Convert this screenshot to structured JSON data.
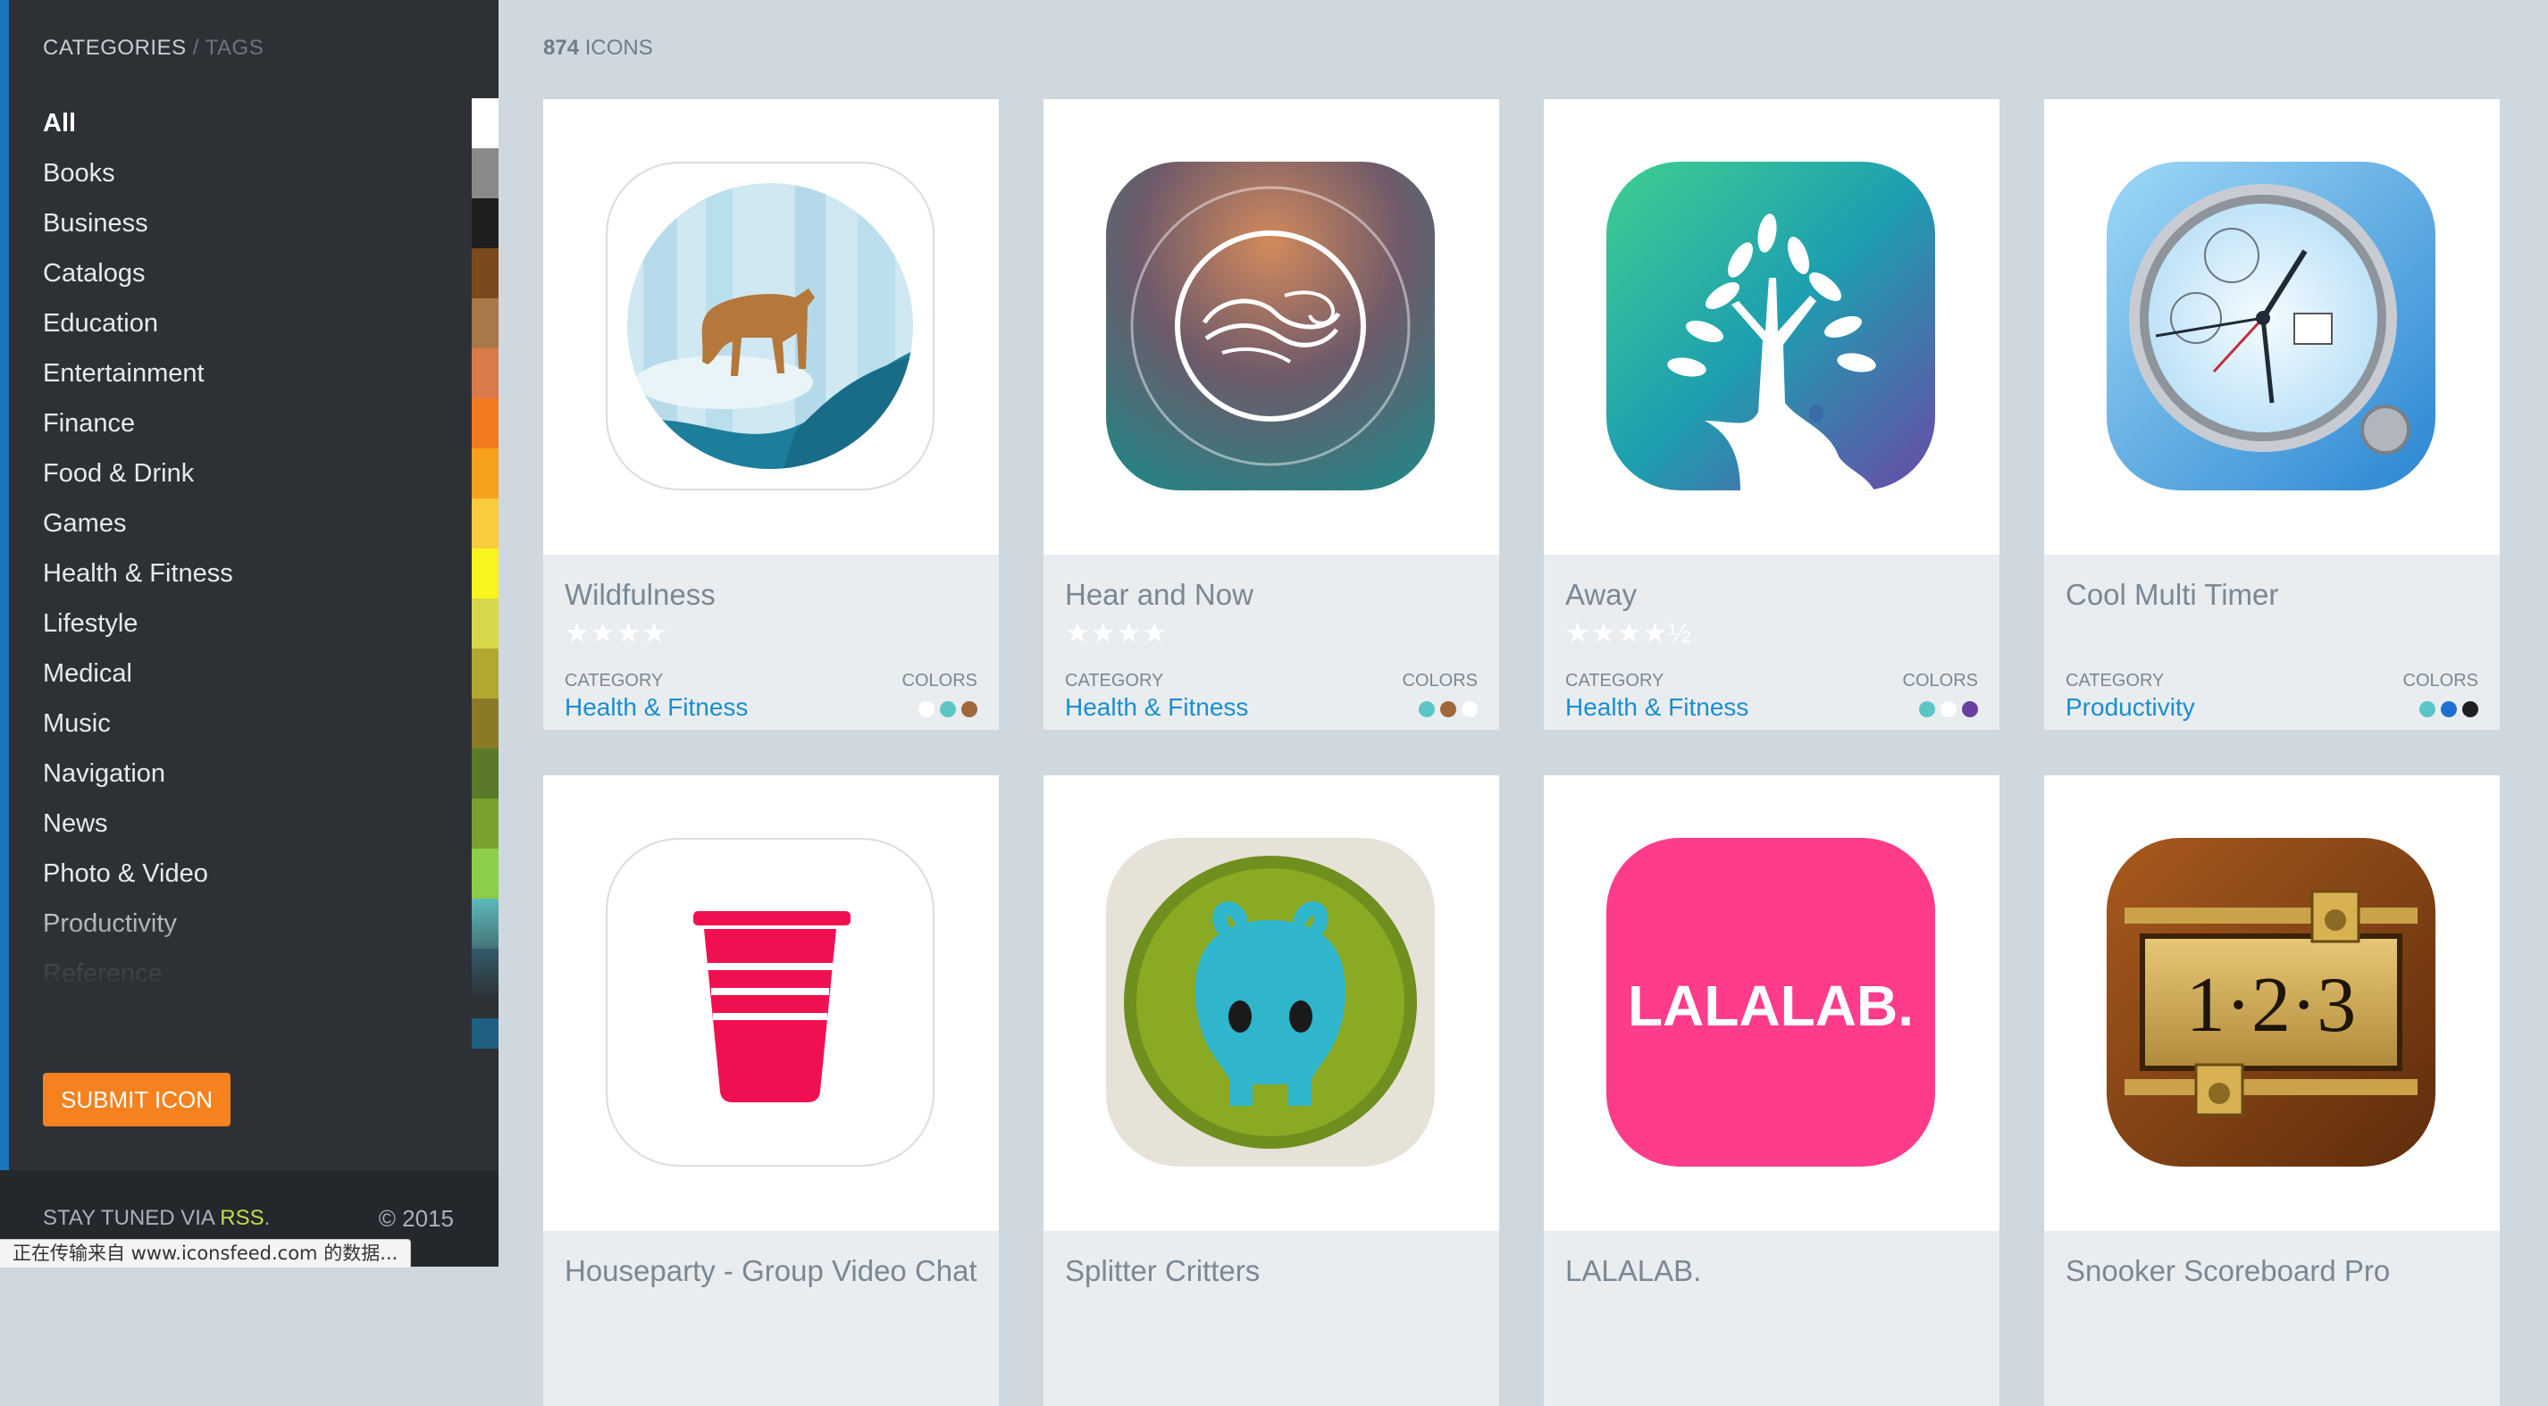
{
  "sidebar": {
    "categories_label": "CATEGORIES",
    "separator": "/",
    "tags_label": "TAGS",
    "categories": [
      "All",
      "Books",
      "Business",
      "Catalogs",
      "Education",
      "Entertainment",
      "Finance",
      "Food & Drink",
      "Games",
      "Health & Fitness",
      "Lifestyle",
      "Medical",
      "Music",
      "Navigation",
      "News",
      "Photo & Video",
      "Productivity",
      "Reference"
    ],
    "active_category": "All",
    "swatch_colors": [
      "#ffffff",
      "#8a8a8a",
      "#1f1f1f",
      "#7a4a1e",
      "#a87848",
      "#d97a4a",
      "#f47a22",
      "#f7a11c",
      "#f8cc3c",
      "#f8f41c",
      "#d6d84a",
      "#b0a830",
      "#8a7a28",
      "#5a7a2a",
      "#7aa030",
      "#8cd04a",
      "#60c0c0",
      "#3a88a0",
      "#1f5f80"
    ],
    "submit_label": "SUBMIT ICON",
    "footer_text": "STAY TUNED VIA ",
    "footer_link": "RSS",
    "footer_period": ".",
    "copyright": "© 2015"
  },
  "main": {
    "count_number": "874",
    "count_label": "ICONS",
    "category_label": "CATEGORY",
    "colors_label": "COLORS"
  },
  "cards": [
    {
      "name": "Wildfulness",
      "stars": "★★★★",
      "category": "Health & Fitness",
      "colors": [
        "#ffffff",
        "#5cc6c6",
        "#a0683a"
      ],
      "icon": "deer-icon"
    },
    {
      "name": "Hear and Now",
      "stars": "★★★★",
      "category": "Health & Fitness",
      "colors": [
        "#5cc6c6",
        "#a0683a",
        "#ffffff"
      ],
      "icon": "breath-swirl-icon"
    },
    {
      "name": "Away",
      "stars": "★★★★½",
      "category": "Health & Fitness",
      "colors": [
        "#5cc6c6",
        "#ffffff",
        "#6a3fa0"
      ],
      "icon": "tree-deer-icon"
    },
    {
      "name": "Cool Multi Timer",
      "stars": "",
      "category": "Productivity",
      "colors": [
        "#5cc6c6",
        "#1f6fd0",
        "#1f1f1f"
      ],
      "icon": "watch-icon"
    },
    {
      "name": "Houseparty - Group Video Chat",
      "stars": "",
      "category": "",
      "colors": [],
      "icon": "party-cup-icon"
    },
    {
      "name": "Splitter Critters",
      "stars": "",
      "category": "",
      "colors": [],
      "icon": "critter-icon"
    },
    {
      "name": "LALALAB.",
      "stars": "",
      "category": "",
      "colors": [],
      "icon": "lalalab-logo-icon",
      "logo_text": "LALALAB."
    },
    {
      "name": "Snooker Scoreboard Pro",
      "stars": "",
      "category": "",
      "colors": [],
      "icon": "scoreboard-icon",
      "logo_text": "1·2·3"
    }
  ],
  "status_bar": "正在传输来自 www.iconsfeed.com 的数据..."
}
